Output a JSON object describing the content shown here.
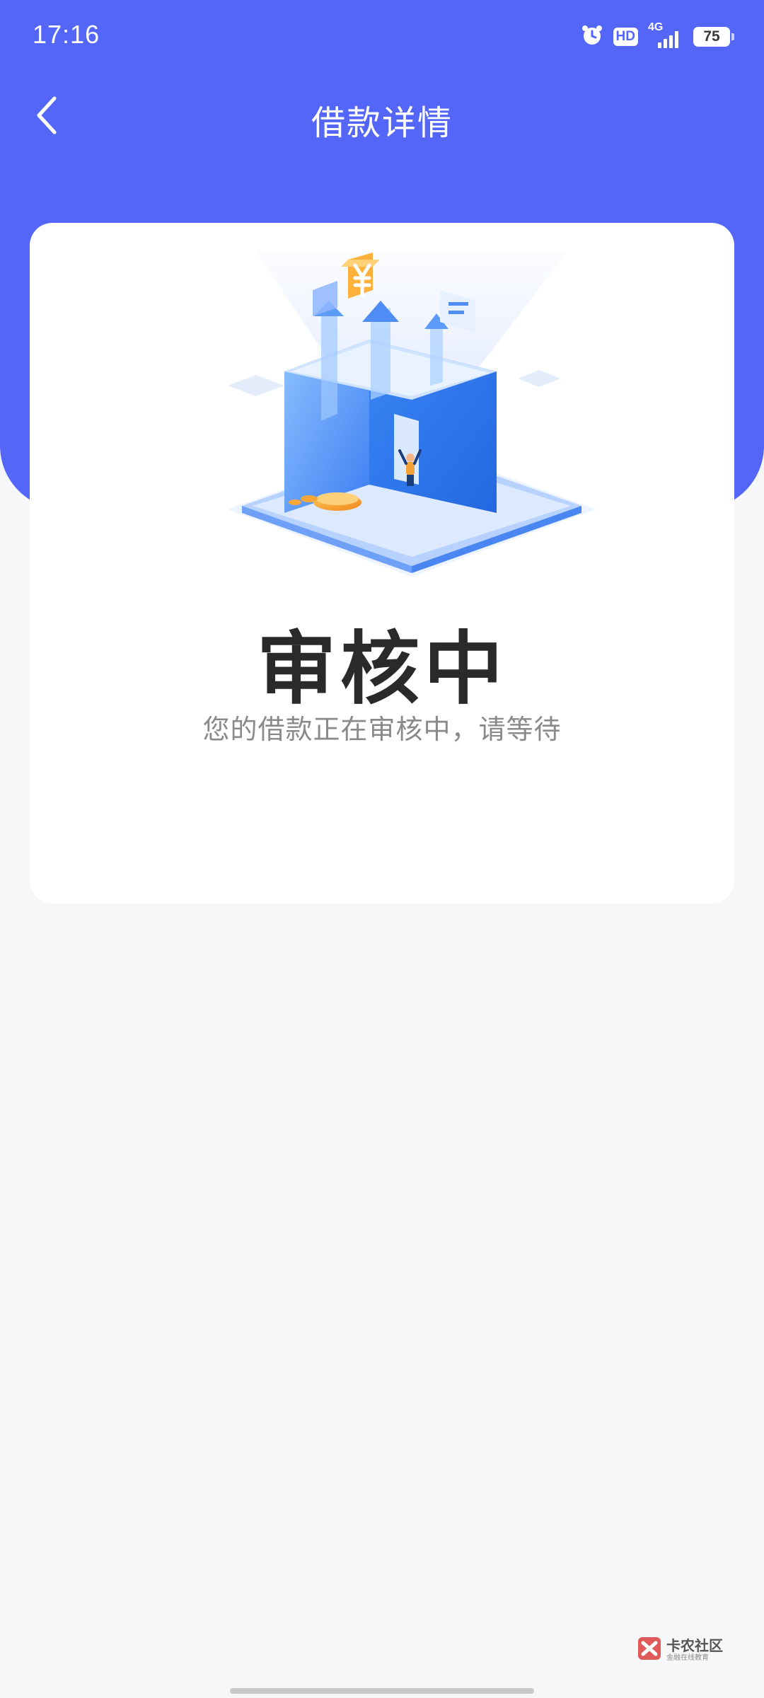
{
  "status_bar": {
    "time": "17:16",
    "hd_label": "HD",
    "network_label": "4G",
    "battery_level": "75"
  },
  "nav": {
    "title": "借款详情"
  },
  "card": {
    "status_title": "审核中",
    "status_description": "您的借款正在审核中，请等待"
  },
  "watermark": {
    "title": "卡农社区",
    "subtitle": "金融在线教育"
  },
  "colors": {
    "header_blue": "#5466f8",
    "background": "#f6f7f9",
    "card": "#ffffff",
    "heading_text": "#2a2a2a",
    "secondary_text": "#8a8a8a"
  },
  "icons": {
    "back": "chevron-left-icon",
    "alarm": "alarm-icon",
    "signal": "signal-icon",
    "illustration": "review-box-illustration"
  }
}
